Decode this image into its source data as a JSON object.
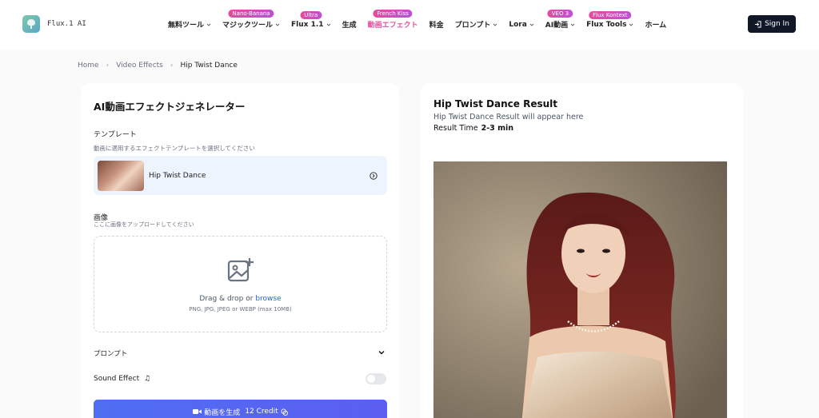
{
  "brand": {
    "name": "Flux.1 AI"
  },
  "nav": [
    {
      "label": "無料ツール",
      "chevron": true,
      "badge": ""
    },
    {
      "label": "マジックツール",
      "chevron": true,
      "badge": "Nano-Banana"
    },
    {
      "label": "Flux 1.1",
      "chevron": true,
      "badge": "Ultra"
    },
    {
      "label": "生成",
      "chevron": false,
      "badge": ""
    },
    {
      "label": "動画エフェクト",
      "chevron": false,
      "badge": "French Kiss",
      "active": true
    },
    {
      "label": "料金",
      "chevron": false,
      "badge": ""
    },
    {
      "label": "プロンプト",
      "chevron": true,
      "badge": ""
    },
    {
      "label": "Lora",
      "chevron": true,
      "badge": ""
    },
    {
      "label": "AI動画",
      "chevron": true,
      "badge": "VEO 3"
    },
    {
      "label": "Flux Tools",
      "chevron": true,
      "badge": "Flux Kontext"
    },
    {
      "label": "ホーム",
      "chevron": false,
      "badge": ""
    }
  ],
  "signin_label": "Sign In",
  "breadcrumb": {
    "home": "Home",
    "section": "Video Effects",
    "current": "Hip Twist Dance"
  },
  "generator": {
    "title": "AI動画エフェクトジェネレーター",
    "template_label": "テンプレート",
    "template_hint": "動画に適用するエフェクトテンプレートを選択してください",
    "template_selected": "Hip Twist Dance",
    "image_label": "画像",
    "image_hint": "ここに画像をアップロードしてください",
    "drop_text": "Drag & drop or ",
    "browse_text": "browse",
    "drop_formats": "PNG, JPG, JPEG or WEBP (max 10MB)",
    "prompt_label": "プロンプト",
    "sound_label": "Sound Effect",
    "sound_on": false,
    "generate_label": "動画を生成",
    "credit_label": "12 Credit"
  },
  "result": {
    "title": "Hip Twist Dance Result",
    "subtitle": "Hip Twist Dance Result will appear here",
    "time_label": "Result Time",
    "time_value": "2-3 min"
  },
  "colors": {
    "accent": "#e64f9b",
    "primary": "#4f6ef2",
    "dark": "#101828"
  }
}
